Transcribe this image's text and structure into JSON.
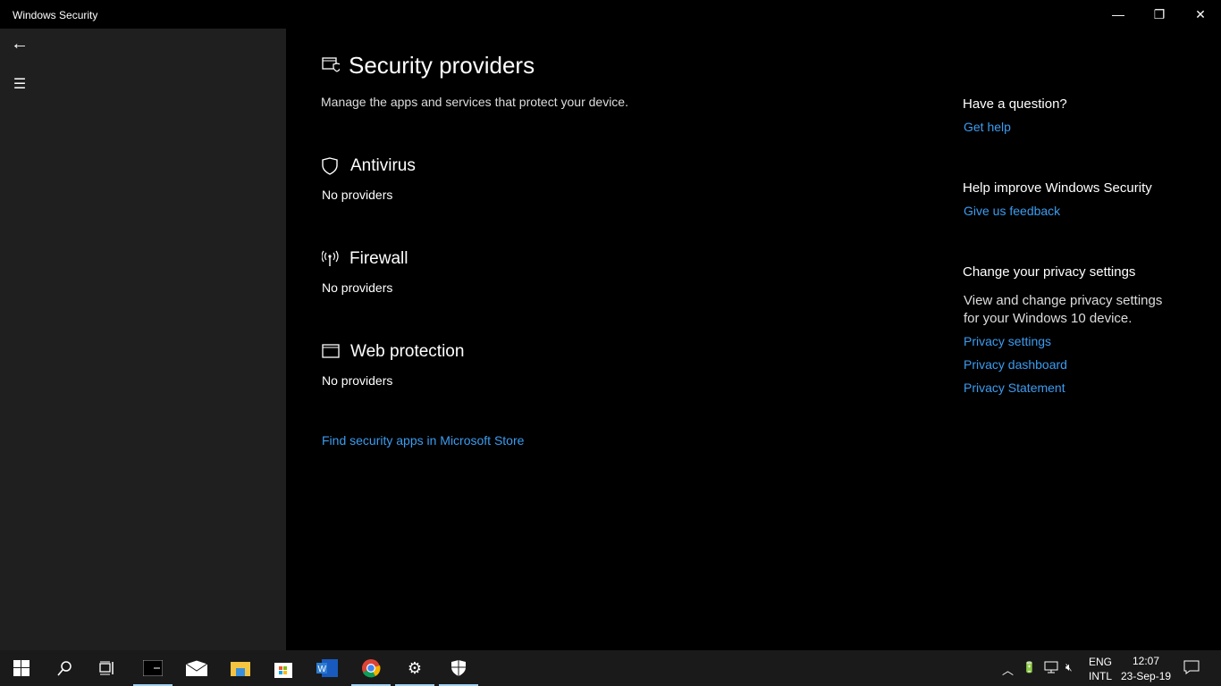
{
  "window": {
    "title": "Windows Security",
    "minimize": "—",
    "restore": "❐",
    "close": "✕"
  },
  "sidebar": {
    "back": "←",
    "menu": "☰"
  },
  "page": {
    "title": "Security providers",
    "subtitle": "Manage the apps and services that protect your device.",
    "sections": [
      {
        "title": "Antivirus",
        "status": "No providers",
        "icon": "shield-icon"
      },
      {
        "title": "Firewall",
        "status": "No providers",
        "icon": "antenna-icon"
      },
      {
        "title": "Web protection",
        "status": "No providers",
        "icon": "browser-icon"
      }
    ],
    "store_link": "Find security apps in Microsoft Store"
  },
  "right": {
    "question": "Have a question?",
    "get_help": "Get help",
    "improve": "Help improve Windows Security",
    "feedback": "Give us feedback",
    "privacy_heading": "Change your privacy settings",
    "privacy_text1": "View and change privacy settings",
    "privacy_text2": "for your Windows 10 device.",
    "links": [
      "Privacy settings",
      "Privacy dashboard",
      "Privacy Statement"
    ]
  },
  "taskbar": {
    "lang1": "ENG",
    "lang2": "INTL",
    "time": "12:07",
    "date": "23-Sep-19"
  }
}
